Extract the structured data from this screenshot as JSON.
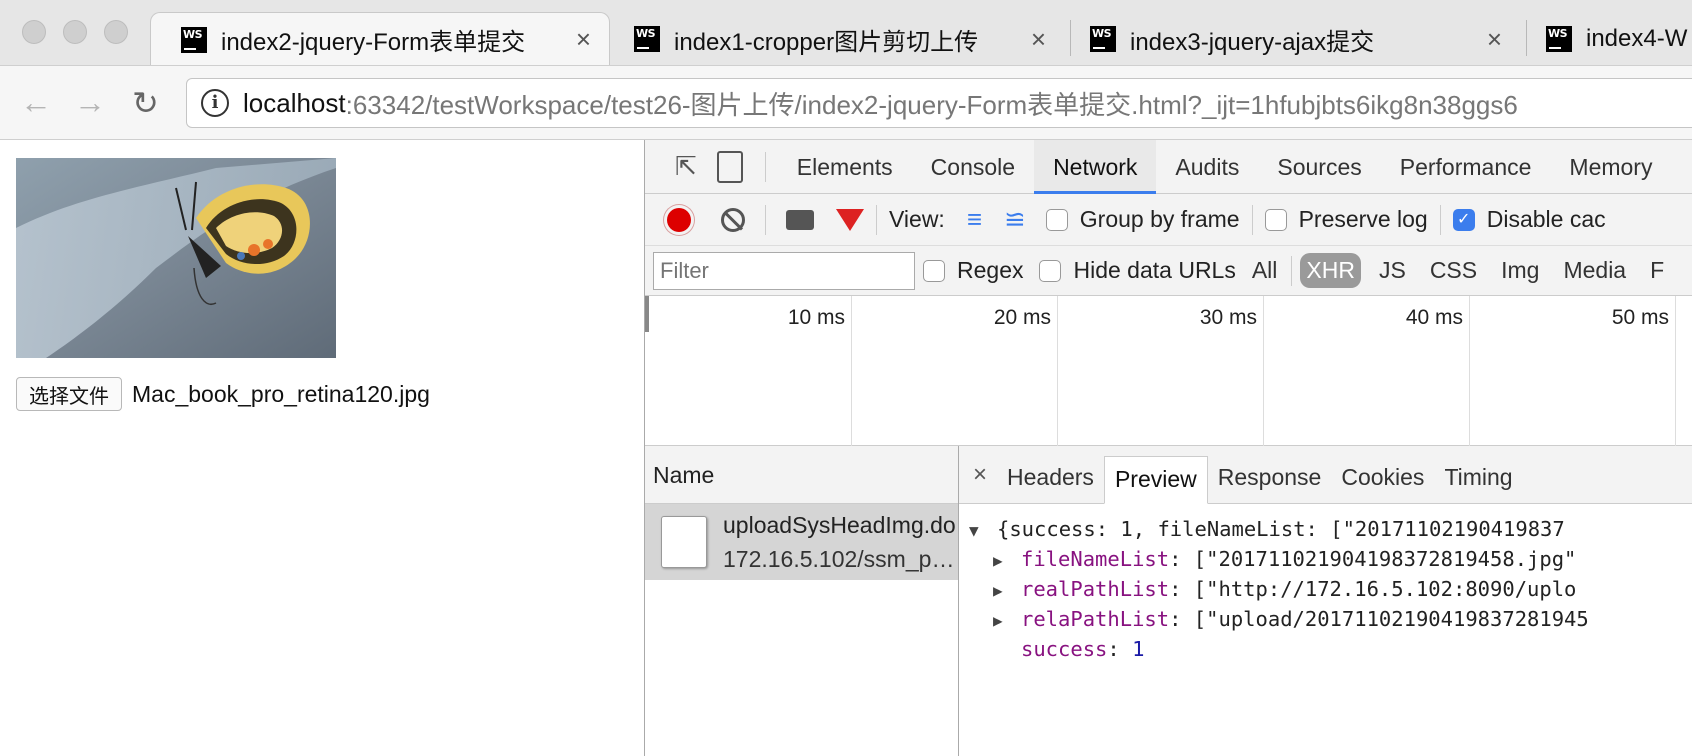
{
  "browser": {
    "tabs": [
      {
        "title": "index2-jquery-Form表单提交",
        "close": "×"
      },
      {
        "title": "index1-cropper图片剪切上传",
        "close": "×"
      },
      {
        "title": "index3-jquery-ajax提交",
        "close": "×"
      },
      {
        "title": "index4-W",
        "close": ""
      }
    ],
    "tab_favicon_text": "WS",
    "address": {
      "host": "localhost",
      "path": ":63342/testWorkspace/test26-图片上传/index2-jquery-Form表单提交.html?_ijt=1hfubjbts6ikg8n38ggs6"
    }
  },
  "page": {
    "choose_file_label": "选择文件",
    "chosen_file_name": "Mac_book_pro_retina120.jpg"
  },
  "devtools": {
    "panels": [
      "Elements",
      "Console",
      "Network",
      "Audits",
      "Sources",
      "Performance",
      "Memory"
    ],
    "active_panel": "Network",
    "toolbar": {
      "view_label": "View:",
      "group_by_frame": {
        "label": "Group by frame",
        "checked": false
      },
      "preserve_log": {
        "label": "Preserve log",
        "checked": false
      },
      "disable_cache": {
        "label": "Disable cac",
        "checked": true
      }
    },
    "filter": {
      "placeholder": "Filter",
      "regex_label": "Regex",
      "hide_data_urls_label": "Hide data URLs",
      "types": [
        "All",
        "XHR",
        "JS",
        "CSS",
        "Img",
        "Media",
        "F"
      ],
      "active_type": "XHR"
    },
    "timeline_ticks": [
      "10 ms",
      "20 ms",
      "30 ms",
      "40 ms",
      "50 ms"
    ],
    "requests": {
      "header": "Name",
      "rows": [
        {
          "name": "uploadSysHeadImg.do",
          "url": "172.16.5.102/ssm_pr…"
        }
      ]
    },
    "detail": {
      "close": "×",
      "tabs": [
        "Headers",
        "Preview",
        "Response",
        "Cookies",
        "Timing"
      ],
      "active_tab": "Preview",
      "preview": {
        "summary": "{success: 1, fileNameList: [\"20171102190419837",
        "lines": [
          {
            "key": "fileNameList",
            "value": "[\"201711021904198372819458.jpg\"",
            "expandable": true
          },
          {
            "key": "realPathList",
            "value": "[\"http://172.16.5.102:8090/uplo",
            "expandable": true
          },
          {
            "key": "relaPathList",
            "value": "[\"upload/20171102190419837281945",
            "expandable": true
          },
          {
            "key": "success",
            "value": "1",
            "expandable": false
          }
        ]
      }
    }
  },
  "colors": {
    "record": "#dd0000",
    "active_tab_underline": "#3b7ded",
    "json_key": "#881280",
    "json_number": "#1a1aa6"
  }
}
